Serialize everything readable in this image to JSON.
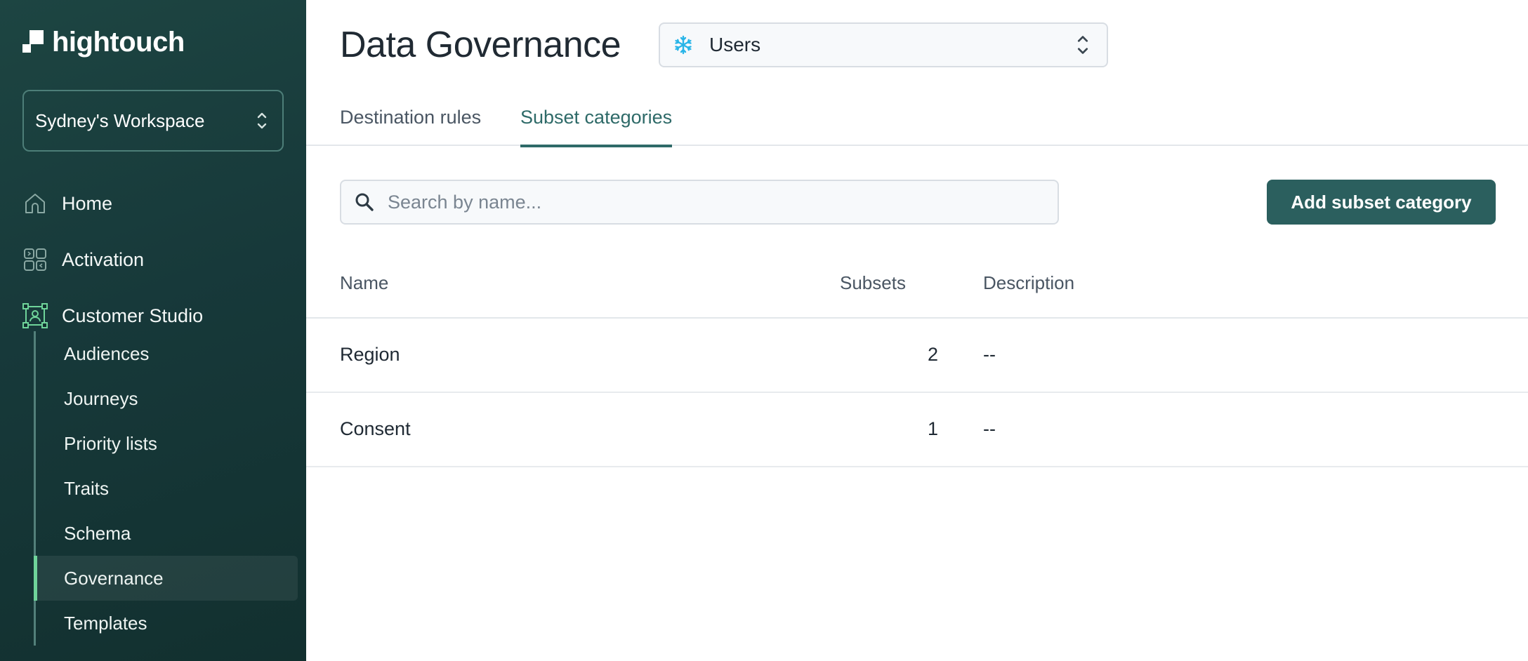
{
  "brand": {
    "name": "hightouch"
  },
  "workspace": {
    "label": "Sydney's Workspace"
  },
  "nav": {
    "items": [
      {
        "label": "Home",
        "icon": "home-icon"
      },
      {
        "label": "Activation",
        "icon": "activation-icon"
      },
      {
        "label": "Customer Studio",
        "icon": "customer-studio-icon"
      }
    ],
    "sub_items": [
      {
        "label": "Audiences"
      },
      {
        "label": "Journeys"
      },
      {
        "label": "Priority lists"
      },
      {
        "label": "Traits"
      },
      {
        "label": "Schema"
      },
      {
        "label": "Governance",
        "active": true
      },
      {
        "label": "Templates"
      }
    ]
  },
  "header": {
    "title": "Data Governance",
    "model_select": {
      "value": "Users",
      "icon": "snowflake-icon"
    }
  },
  "tabs": [
    {
      "label": "Destination rules",
      "active": false
    },
    {
      "label": "Subset categories",
      "active": true
    }
  ],
  "search": {
    "placeholder": "Search by name...",
    "value": ""
  },
  "actions": {
    "add_label": "Add subset category"
  },
  "table": {
    "columns": {
      "name": "Name",
      "subsets": "Subsets",
      "description": "Description"
    },
    "rows": [
      {
        "name": "Region",
        "subsets": "2",
        "description": "--"
      },
      {
        "name": "Consent",
        "subsets": "1",
        "description": "--"
      }
    ]
  },
  "colors": {
    "sidebar_bg": "#1d4542",
    "accent": "#2e6a68",
    "button_bg": "#2b5f5e",
    "active_indicator": "#6fd49a",
    "snowflake": "#29b5e8"
  }
}
